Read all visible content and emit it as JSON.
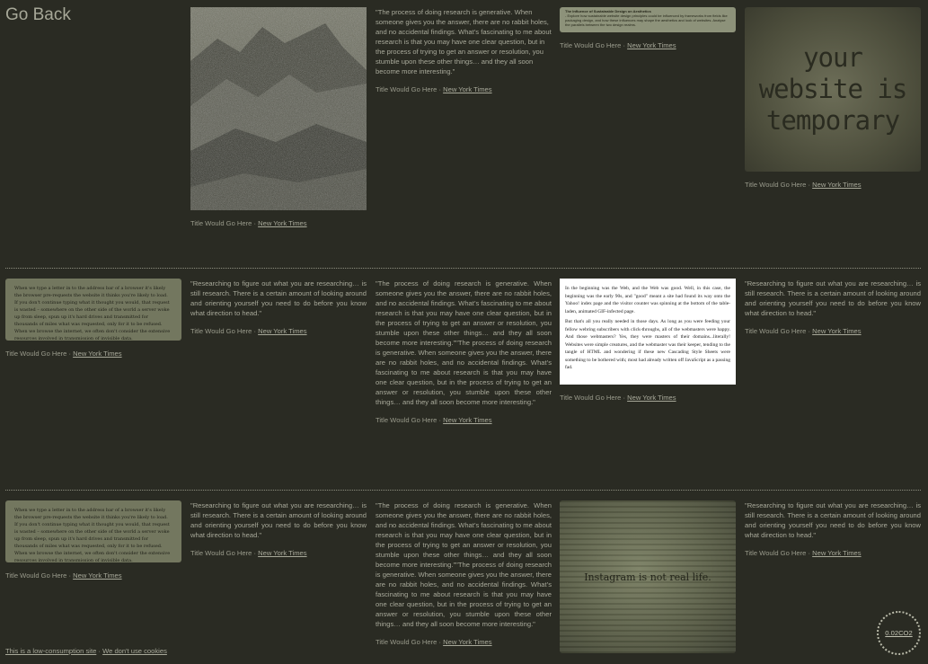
{
  "nav": {
    "go_back": "Go Back"
  },
  "footer": {
    "low_consumption": "This is a low-consumption site",
    "separator": "·",
    "no_cookies": "We don't use cookies"
  },
  "co2_badge": "0.02CO2",
  "caption": {
    "title": "Title Would Go Here",
    "sep": " · ",
    "source": "New York Times"
  },
  "quotes": {
    "short": "\"Researching to figure out what you are researching… is still research. There is a certain amount of looking around and orienting yourself you need to do before you know what direction to head.\"",
    "medium": "\"The process of doing research is generative. When someone gives you the answer, there are no rabbit holes, and no accidental findings. What’s fascinating to me about research is that you may have one clear question, but in the process of trying to get an answer or resolution, you stumble upon these other things… and they all soon become more interesting.\"",
    "long": "\"The process of doing research is generative. When someone gives you the answer, there are no rabbit holes, and no accidental findings. What’s fascinating to me about research is that you may have one clear question, but in the process of trying to get an answer or resolution, you stumble upon these other things… and they all soon become more interesting.\"\"The process of doing research is generative. When someone gives you the answer, there are no rabbit holes, and no accidental findings. What’s fascinating to me about research is that you may have one clear question, but in the process of trying to get an answer or resolution, you stumble upon these other things… and they all soon become more interesting.\""
  },
  "images": {
    "temporary_text": "your website is temporary",
    "instagram_text": "Instagram is not real life.",
    "small_card_title": "The Influence of Sustainable Design on Aesthetics",
    "small_card_body": "- Explore how sustainable website design principles could be influenced by frameworks from fields like packaging design, and how these influences may shape the aesthetics and look of websites. Analyse the parallels between the two design realms.",
    "text_card": "When we type a letter in to the address bar of a browser it's likely the browser pre-requests the website it thinks you're likely to load. If you don't continue typing what it thought you would, that request is wasted – somewhere on the other side of the world a server woke up from sleep, spun up it's hard drives and transmitted for thousands of miles what was requested, only for it to be refused. When we browse the internet, we often don't consider the extensive resources involved in transmission of invisible data.",
    "white_p1": "In the beginning was the Web, and the Web was good. Well, in this case, the beginning was the early 90s, and \"good\" meant a site had found its way onto the Yahoo! index page and the visitor counter was spinning at the bottom of the table-laden, animated GIF-infected page.",
    "white_p2": "But that's all you really needed in those days. As long as you were feeding your fellow webring subscribers with click-throughs, all of the webmasters were happy. And those webmasters? Yes, they were masters of their domains...literally! Websites were simple creatures, and the webmaster was their keeper, tending to the tangle of HTML and wondering if these new Cascading Style Sheets were something to be bothered with; most had already written off JavaScript as a passing fad."
  }
}
